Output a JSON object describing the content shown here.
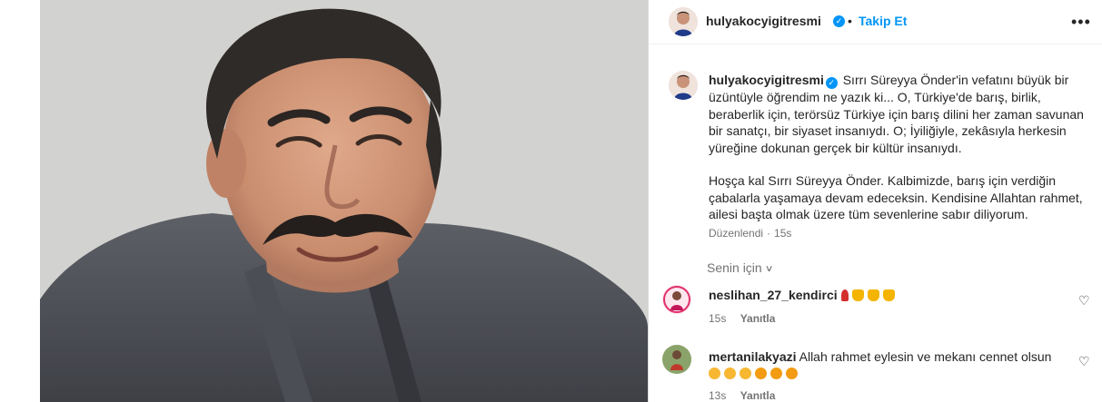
{
  "post": {
    "username": "hulyakocyigitresmi",
    "verified": true,
    "separator": "•",
    "follow_label": "Takip Et",
    "more_label": "•••"
  },
  "caption": {
    "username": "hulyakocyigitresmi",
    "paragraph1": "Sırrı Süreyya Önder'in vefatını büyük bir üzüntüyle öğrendim ne yazık ki... O, Türkiye'de barış, birlik, beraberlik için, terörsüz Türkiye için barış dilini her zaman savunan bir sanatçı, bir siyaset insanıydı. O; İyiliğiyle, zekâsıyla herkesin yüreğine dokunan gerçek bir kültür insanıydı.",
    "paragraph2": "Hoşça kal Sırrı Süreyya Önder. Kalbimizde, barış için verdiğin çabalarla yaşamaya devam edeceksin. Kendisine Allahtan rahmet, ailesi başta olmak üzere tüm sevenlerine sabır diliyorum.",
    "edited_label": "Düzenlendi",
    "separator": "·",
    "time": "15s"
  },
  "for_you": {
    "label": "Senin için"
  },
  "comments": [
    {
      "username": "neslihan_27_kendirci",
      "text": "",
      "emojis": [
        "rose-emoji",
        "folded-hands-emoji",
        "folded-hands-emoji",
        "folded-hands-emoji"
      ],
      "time": "15s",
      "reply_label": "Yanıtla"
    },
    {
      "username": "mertanilakyazi",
      "text": "Allah rahmet eylesin ve mekanı cennet olsun",
      "emojis": [
        "crying-face-emoji",
        "crying-face-emoji",
        "crying-face-emoji",
        "sad-face-emoji",
        "sad-face-emoji",
        "sad-face-emoji"
      ],
      "time": "13s",
      "reply_label": "Yanıtla"
    }
  ],
  "colors": {
    "link_blue": "#0095f6",
    "text_primary": "#262626",
    "text_secondary": "#737373"
  }
}
